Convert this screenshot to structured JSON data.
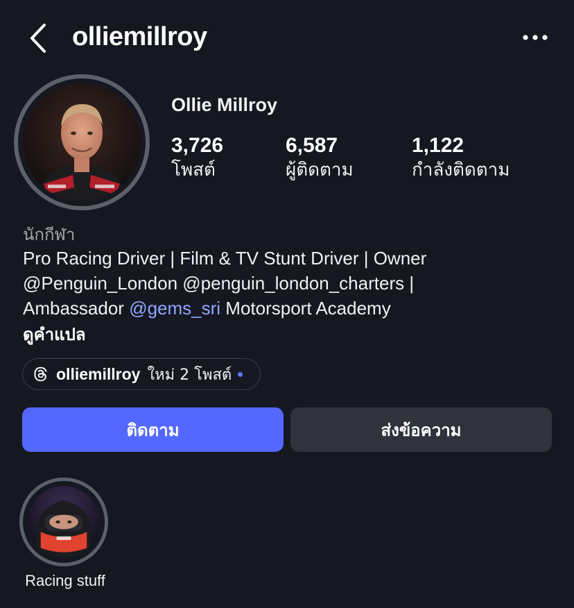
{
  "header": {
    "username": "olliemillroy",
    "back_icon": "chevron-left-icon",
    "more_icon": "more-horizontal-icon"
  },
  "profile": {
    "display_name": "Ollie Millroy",
    "stats": [
      {
        "value": "3,726",
        "label": "โพสต์"
      },
      {
        "value": "6,587",
        "label": "ผู้ติดตาม"
      },
      {
        "value": "1,122",
        "label": "กำลังติดตาม"
      }
    ],
    "category": "นักกีฬา",
    "bio": {
      "line1": "Pro Racing Driver | Film & TV Stunt Driver | Owner",
      "line2": "@Penguin_London @penguin_london_charters |",
      "line3_before": "Ambassador ",
      "line3_mention": "@gems_sri",
      "line3_after": " Motorsport Academy"
    },
    "translate_label": "ดูคำแปล"
  },
  "threads_badge": {
    "icon": "threads-icon",
    "username": "olliemillroy",
    "new_posts": "ใหม่ 2 โพสต์"
  },
  "actions": {
    "follow_label": "ติดตาม",
    "message_label": "ส่งข้อความ"
  },
  "highlights": [
    {
      "label": "Racing stuff"
    }
  ],
  "colors": {
    "background": "#151821",
    "follow_button": "#5468ff",
    "message_button": "#30333b",
    "mention": "#8ea7ff",
    "new_dot": "#5b7bff"
  }
}
